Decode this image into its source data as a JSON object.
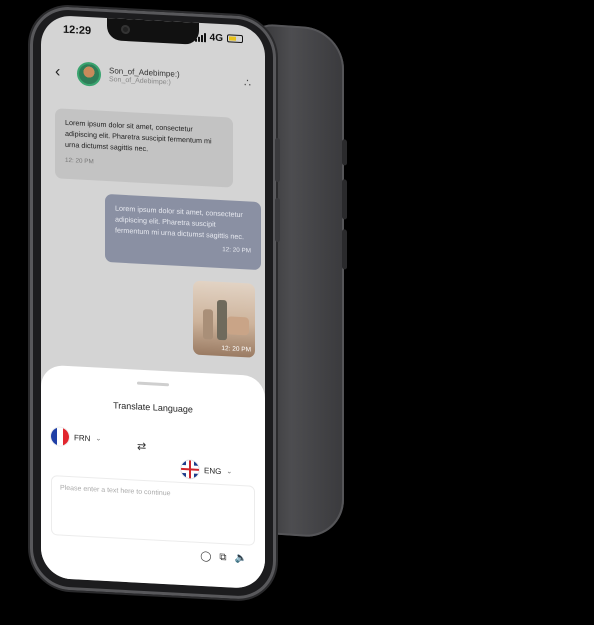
{
  "status_bar": {
    "time": "12:29",
    "network": "4G"
  },
  "header": {
    "contact_name": "Son_of_Adebimpe:)",
    "contact_handle": "Son_of_Adebimpe:)"
  },
  "messages": [
    {
      "direction": "incoming",
      "text": "Lorem ipsum dolor sit amet, consectetur adipiscing elit. Pharetra suscipit fermentum mi urna dictumst sagittis nec.",
      "time": "12: 20 PM"
    },
    {
      "direction": "outgoing",
      "text": "Lorem ipsum dolor sit amet, consectetur adipiscing elit. Pharetra suscipit fermentum mi urna dictumst sagittis nec.",
      "time": "12: 20 PM"
    }
  ],
  "photo_message": {
    "time": "12: 20 PM"
  },
  "translate": {
    "title": "Translate Language",
    "source_lang": "FRN",
    "target_lang": "ENG",
    "input_placeholder": "Please enter a text here to continue"
  },
  "colors": {
    "chat_bg": "#d4d4d4",
    "incoming_bubble": "#c3c3c3",
    "outgoing_bubble": "#8a90a3",
    "battery": "#e8c21a"
  }
}
